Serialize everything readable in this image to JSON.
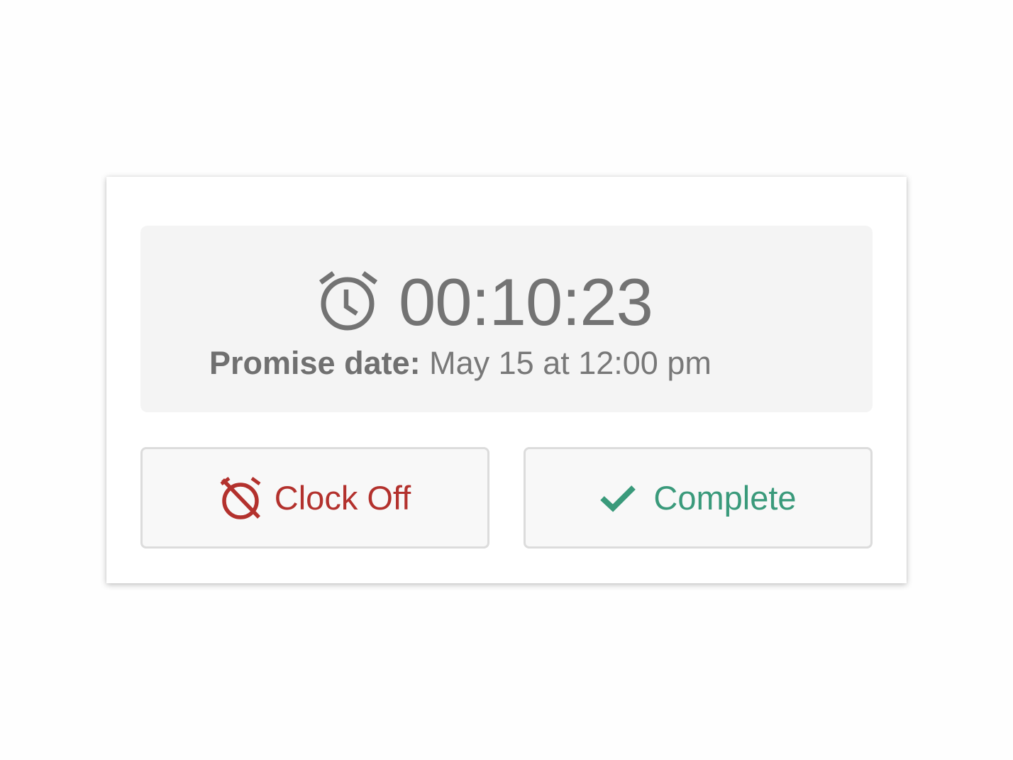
{
  "timer": {
    "icon": "alarm-clock-icon",
    "elapsed": "00:10:23",
    "promise_label": "Promise date:",
    "promise_value": "May 15 at 12:00 pm"
  },
  "actions": {
    "clock_off": {
      "label": "Clock Off",
      "icon": "alarm-off-icon",
      "color": "#b3312d"
    },
    "complete": {
      "label": "Complete",
      "icon": "checkmark-icon",
      "color": "#3a9a7b"
    }
  },
  "colors": {
    "timer_text": "#737373",
    "panel_background": "#f4f4f4",
    "button_background": "#f8f8f8",
    "button_border": "#dcdcdc"
  }
}
